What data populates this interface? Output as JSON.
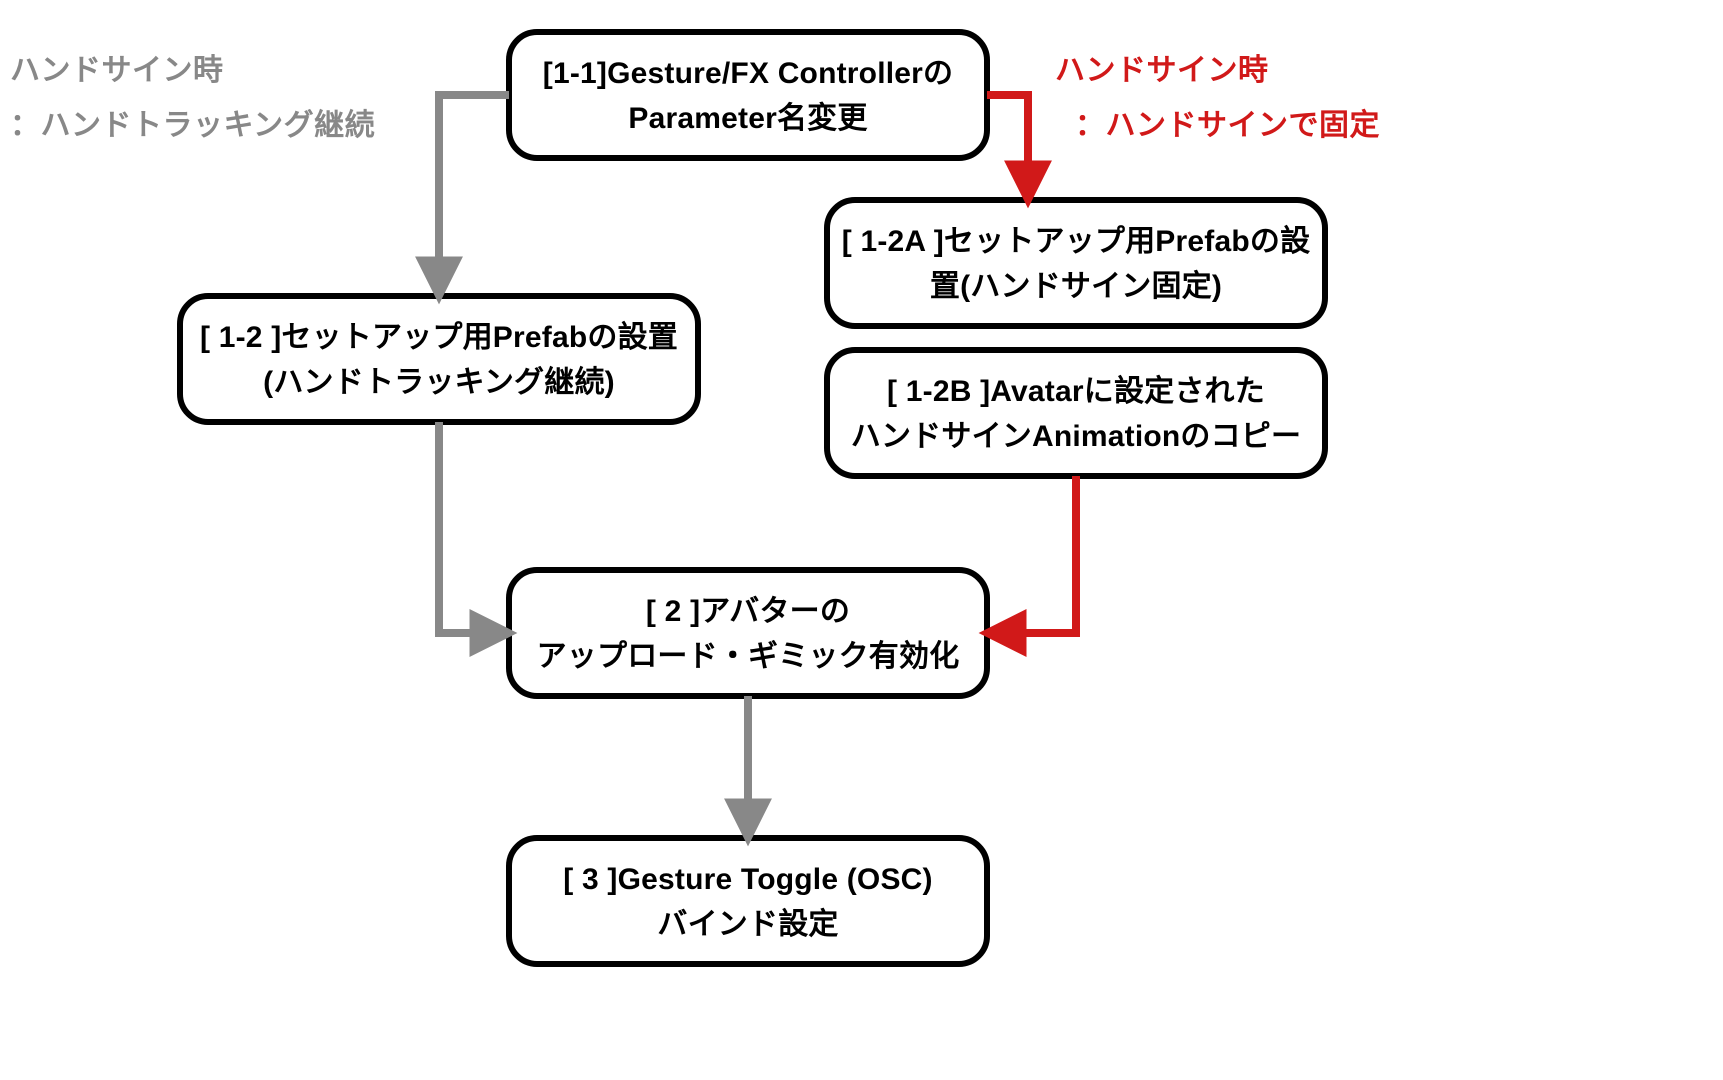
{
  "labels": {
    "left_line1": "ハンドサイン時",
    "left_line2": "：ハンドトラッキング継続",
    "right_line1": "ハンドサイン時",
    "right_line2": "：ハンドサインで固定"
  },
  "nodes": {
    "n11_line1": "[1-1]Gesture/FX Controllerの",
    "n11_line2": "Parameter名変更",
    "n12_line1": "[ 1-2 ]セットアップ用Prefabの設置",
    "n12_line2": "(ハンドトラッキング継続)",
    "n12a_line1": "[ 1-2A ]セットアップ用Prefabの設",
    "n12a_line2": "置(ハンドサイン固定)",
    "n12b_line1": "[ 1-2B ]Avatarに設定された",
    "n12b_line2": "ハンドサインAnimationのコピー",
    "n2_line1": "[ 2 ]アバターの",
    "n2_line2": "アップロード・ギミック有効化",
    "n3_line1": "[ 3 ]Gesture Toggle (OSC)",
    "n3_line2": "バインド設定"
  },
  "colors": {
    "gray": "#888888",
    "red": "#d11919",
    "black": "#000000"
  }
}
